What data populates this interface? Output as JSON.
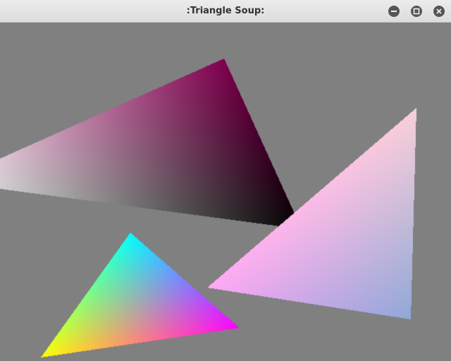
{
  "window": {
    "title": ":Triangle Soup:",
    "buttons": [
      {
        "name": "minimize",
        "icon": "minus-icon"
      },
      {
        "name": "maximize",
        "icon": "square-icon"
      },
      {
        "name": "close",
        "icon": "x-icon"
      }
    ]
  },
  "scene": {
    "background_color": "#808080",
    "triangles": [
      {
        "vertex_colors": [
          "#f4f4f4",
          "#80004f",
          "#000000"
        ]
      },
      {
        "vertex_colors": [
          "#f8d0d8",
          "#ffa8f4",
          "#90a8d8"
        ]
      },
      {
        "vertex_colors": [
          "#00ffff",
          "#ffff00",
          "#ff00ff"
        ]
      }
    ]
  }
}
